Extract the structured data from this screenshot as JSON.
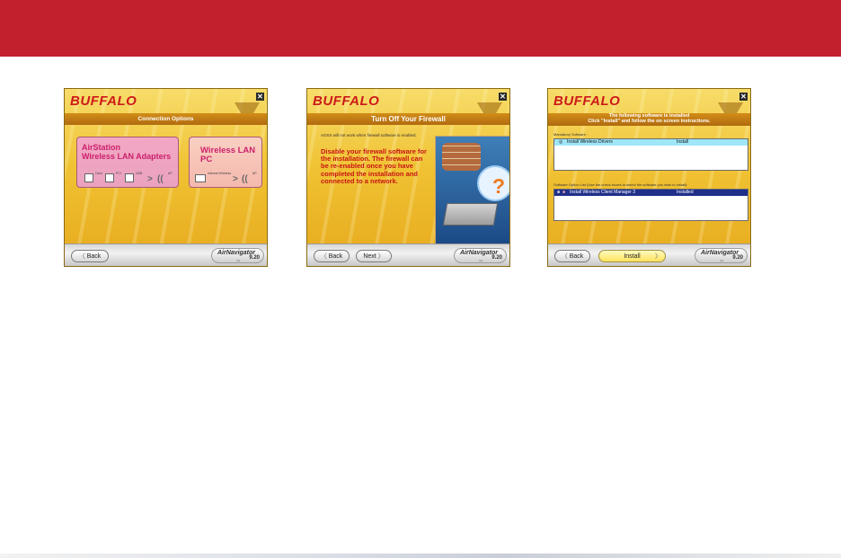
{
  "colors": {
    "header_bar": "#c3202d",
    "window_gold": "#f0c233",
    "brand_red": "#cc1a1a"
  },
  "brand": "BUFFALO",
  "close_glyph": "✕",
  "app_badge": {
    "name": "AirNavigator",
    "ver_label": "Ver",
    "version": "9.20"
  },
  "window1": {
    "title": "Connection Options",
    "back_label": "Back",
    "card1": {
      "title_line1": "AirStation",
      "title_line2": "Wireless LAN Adapters",
      "devices": [
        "Card",
        "PCI",
        "USB"
      ],
      "ap_label": "AP"
    },
    "card2": {
      "title": "Wireless LAN PC",
      "device": "Internal Wireless",
      "ap_label": "AP"
    }
  },
  "window2": {
    "title": "Turn Off Your Firewall",
    "note": "AOSS will not work when firewall software is enabled.",
    "warning": "Disable your firewall software for the installation. The firewall can be re-enabled once you have completed the installation and connected to a network.",
    "back_label": "Back",
    "next_label": "Next"
  },
  "window3": {
    "header_line1": "The following software is installed",
    "header_line2": "Click \"Install\" and follow the on screen instructions.",
    "mandatory_label": "Mandatory Software :",
    "mandatory_item": {
      "name": "Install Wireless Drivers",
      "status": "Install"
    },
    "option_label": "Software Option List (Use the check boxes to select the software you wish to install):",
    "option_item": {
      "name": "Install Wireless Client Manager 3",
      "status": "Installed"
    },
    "back_label": "Back",
    "install_label": "Install"
  }
}
